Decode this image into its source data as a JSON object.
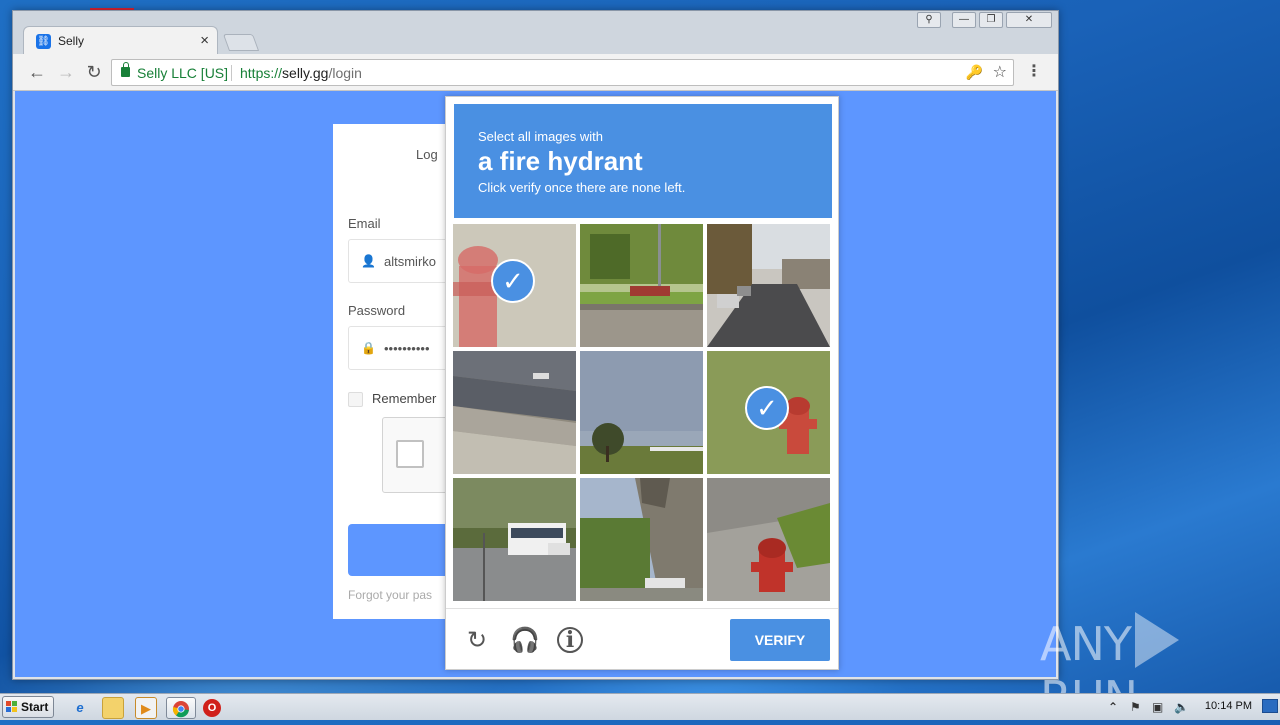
{
  "browser": {
    "tab_title": "Selly",
    "tab_close": "×",
    "tab_favicon": "selly-icon",
    "security_label": "Selly LLC [US]",
    "url_scheme": "https://",
    "url_host": "selly.gg",
    "url_path": "/login",
    "win_ctrls": {
      "user": "⚲",
      "minimize": "—",
      "restore": "❐",
      "close": "✕"
    }
  },
  "login": {
    "title": "Log",
    "email_label": "Email",
    "email_value": "altsmirko",
    "password_label": "Password",
    "password_value": "••••••••••",
    "remember_label": "Remember",
    "forgot_text": "Forgot your pas"
  },
  "captcha": {
    "instruction_line1": "Select all images with",
    "target_object": "a fire hydrant",
    "instruction_line2": "Click verify once there are none left.",
    "verify_label": "VERIFY",
    "icons": [
      "reload-icon",
      "audio-icon",
      "info-icon"
    ],
    "tiles_selected": [
      true,
      false,
      false,
      false,
      false,
      true,
      false,
      false,
      false
    ],
    "accent_color": "#4a90e2"
  },
  "taskbar": {
    "start_label": "Start",
    "clock": "10:14 PM"
  },
  "watermark": {
    "left": "ANY",
    "right": "RUN"
  }
}
